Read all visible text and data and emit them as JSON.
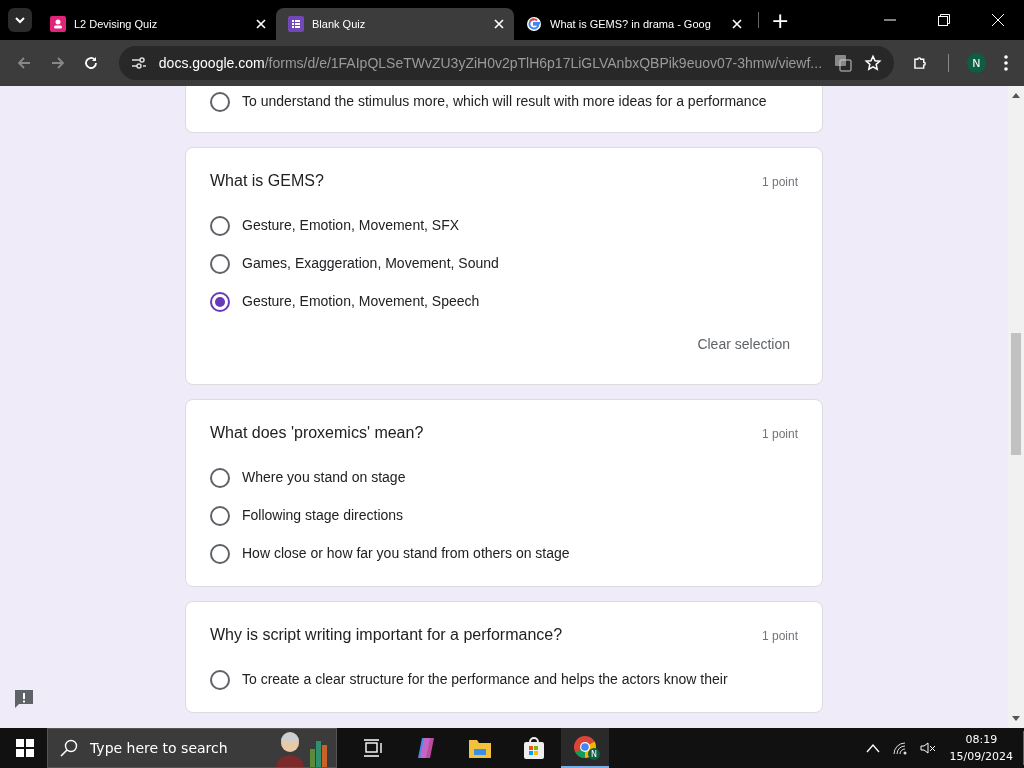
{
  "browser": {
    "tabs": [
      {
        "title": "L2 Devising Quiz",
        "kind": "forms-pink",
        "selected": false
      },
      {
        "title": "Blank Quiz",
        "kind": "forms-purple",
        "selected": true
      },
      {
        "title": "What is GEMS? in drama - Goog",
        "kind": "google",
        "selected": false
      }
    ],
    "new_tab": "+",
    "url_host": "docs.google.com",
    "url_path": "/forms/d/e/1FAIpQLSeTWvZU3yZiH0v2pTlH6p17LiGLVAnbxQBPik9euov07-3hmw/viewf...",
    "profile": "N"
  },
  "questions": [
    {
      "options": [
        {
          "label": "To understand the stimulus more, which will result with more ideas for a performance",
          "selected": false
        }
      ]
    },
    {
      "title": "What is GEMS?",
      "points": "1 point",
      "options": [
        {
          "label": "Gesture, Emotion, Movement, SFX",
          "selected": false
        },
        {
          "label": "Games, Exaggeration, Movement, Sound",
          "selected": false
        },
        {
          "label": "Gesture, Emotion, Movement, Speech",
          "selected": true
        }
      ],
      "clear": "Clear selection"
    },
    {
      "title": "What does 'proxemics' mean?",
      "points": "1 point",
      "options": [
        {
          "label": "Where you stand on stage",
          "selected": false
        },
        {
          "label": "Following stage directions",
          "selected": false
        },
        {
          "label": "How close or how far you stand from others on stage",
          "selected": false
        }
      ]
    },
    {
      "title": "Why is script writing important for a performance?",
      "points": "1 point",
      "options": [
        {
          "label": "To create a clear structure for the performance and helps the actors know their",
          "selected": false
        }
      ]
    }
  ],
  "taskbar": {
    "search_placeholder": "Type here to search",
    "time": "08:19",
    "date": "15/09/2024",
    "chrome_profile": "N"
  }
}
